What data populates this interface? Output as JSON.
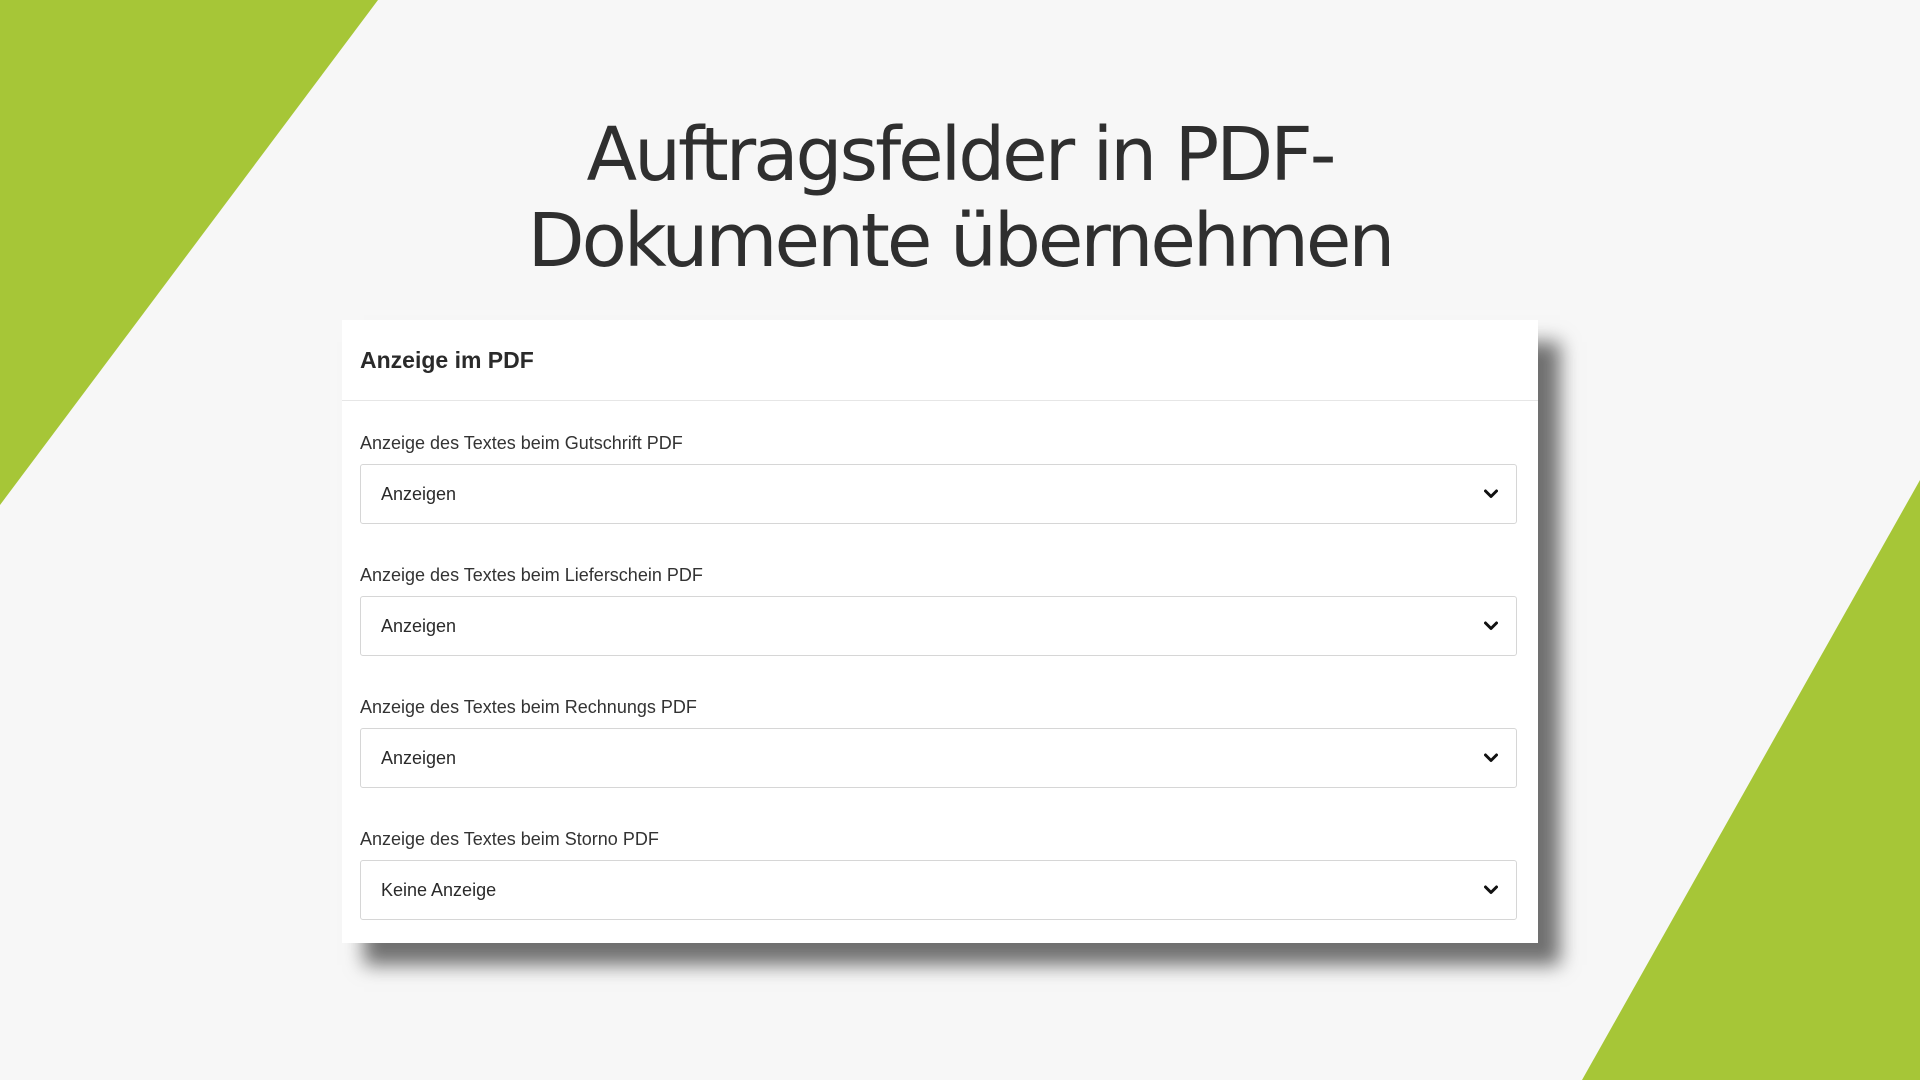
{
  "page": {
    "title_line1": "Auftragsfelder in PDF-",
    "title_line2": "Dokumente übernehmen"
  },
  "colors": {
    "accent_green": "#a6c637",
    "background": "#f7f7f7",
    "card_bg": "#ffffff"
  },
  "panel": {
    "title": "Anzeige im PDF",
    "fields": [
      {
        "label": "Anzeige des Textes beim Gutschrift PDF",
        "value": "Anzeigen",
        "icon": "chevron-down-icon"
      },
      {
        "label": "Anzeige des Textes beim Lieferschein PDF",
        "value": "Anzeigen",
        "icon": "chevron-down-icon"
      },
      {
        "label": "Anzeige des Textes beim Rechnungs PDF",
        "value": "Anzeigen",
        "icon": "chevron-down-icon"
      },
      {
        "label": "Anzeige des Textes beim Storno PDF",
        "value": "Keine Anzeige",
        "icon": "chevron-down-icon"
      }
    ]
  }
}
